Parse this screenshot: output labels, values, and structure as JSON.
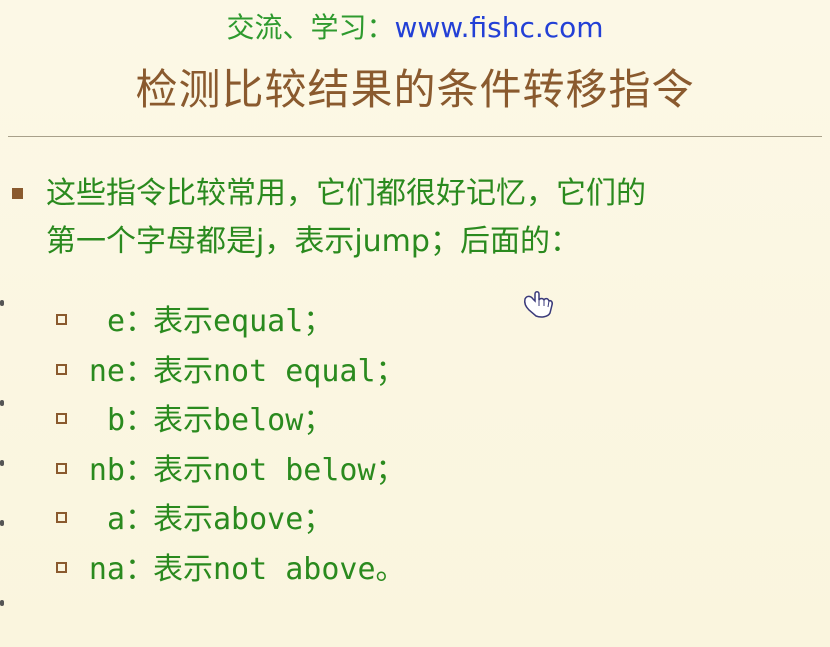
{
  "header": {
    "label": "交流、学习：",
    "url": "www.fishc.com"
  },
  "title": "检测比较结果的条件转移指令",
  "intro": {
    "line1": "这些指令比较常用，它们都很好记忆，它们的",
    "line2": "第一个字母都是j，表示jump；后面的："
  },
  "items": [
    {
      "code": "e",
      "sep": "：",
      "prefix": "表示",
      "meaning": "equal；"
    },
    {
      "code": "ne",
      "sep": "：",
      "prefix": "表示",
      "meaning": "not equal；"
    },
    {
      "code": "b",
      "sep": "：",
      "prefix": "表示",
      "meaning": "below；"
    },
    {
      "code": "nb",
      "sep": "：",
      "prefix": "表示",
      "meaning": "not below；"
    },
    {
      "code": "a",
      "sep": "：",
      "prefix": "表示",
      "meaning": "above；"
    },
    {
      "code": "na",
      "sep": "：",
      "prefix": "表示",
      "meaning": "not above。"
    }
  ],
  "colors": {
    "background": "#fbf7e3",
    "title": "#8a5a2e",
    "body_text": "#2a8a1e",
    "url": "#2340d6",
    "bullet": "#8a5a2e"
  },
  "icons": {
    "cursor": "pointer-hand-icon",
    "main_bullet": "filled-square-bullet",
    "sub_bullet": "hollow-square-bullet"
  }
}
